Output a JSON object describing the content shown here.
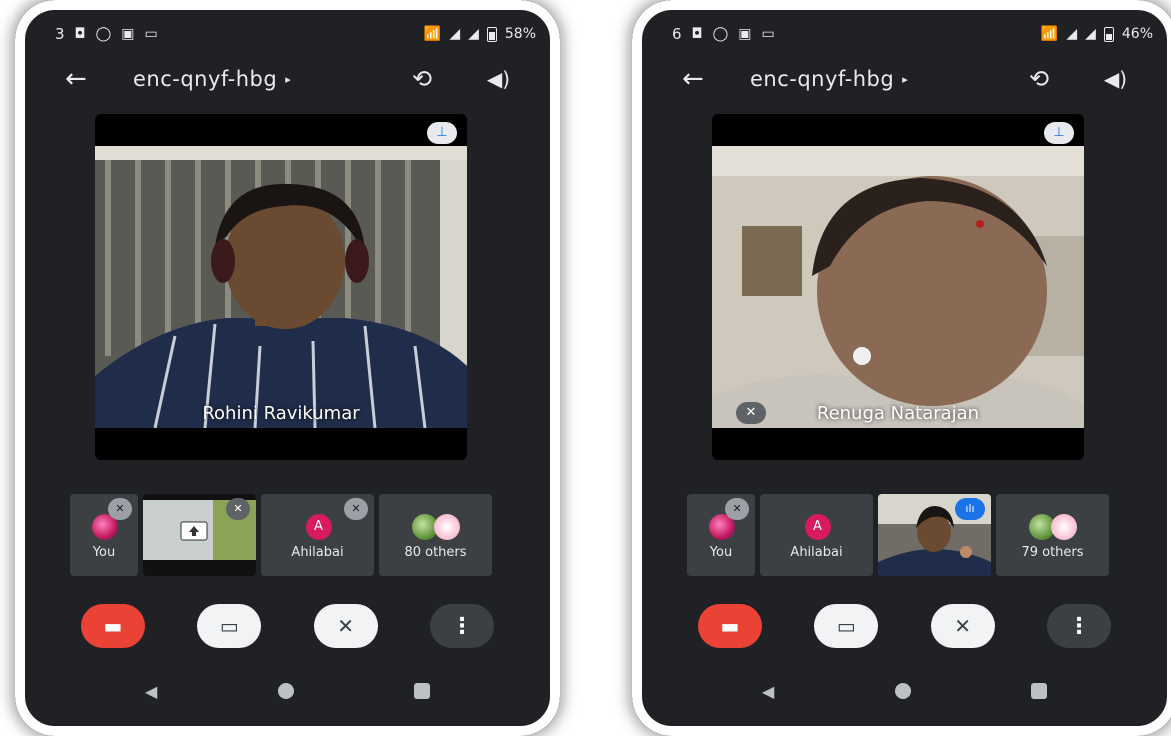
{
  "left_phone": {
    "status": {
      "clock_fragment": "3",
      "battery": "58%"
    },
    "meeting_code": "enc-qnyf-hbg",
    "main_participant": {
      "name": "Rohini Ravikumar",
      "muted": false
    },
    "strip": [
      {
        "label": "You",
        "muted": true
      },
      {
        "label": "",
        "presenting": true
      },
      {
        "label": "Ahilabai",
        "avatar_letter": "A",
        "muted": true
      },
      {
        "label": "80 others"
      }
    ]
  },
  "right_phone": {
    "status": {
      "clock_fragment": "6",
      "battery": "46%"
    },
    "meeting_code": "enc-qnyf-hbg",
    "main_participant": {
      "name": "Renuga Natarajan",
      "muted": true
    },
    "strip": [
      {
        "label": "You",
        "muted": true
      },
      {
        "label": "Ahilabai",
        "avatar_letter": "A"
      },
      {
        "label": "",
        "speaking": true
      },
      {
        "label": "79 others"
      }
    ]
  },
  "icons": {
    "back": "←",
    "caret": "▸",
    "switch_camera": "⟲",
    "speaker": "🔊",
    "pin": "📌",
    "mic_off": "🎙",
    "camera_off": "▭",
    "hangup": "☎",
    "more": "⋮"
  },
  "colors": {
    "hangup": "#ea4335",
    "accent": "#1a73e8",
    "avatar_pink": "#d81b60"
  }
}
